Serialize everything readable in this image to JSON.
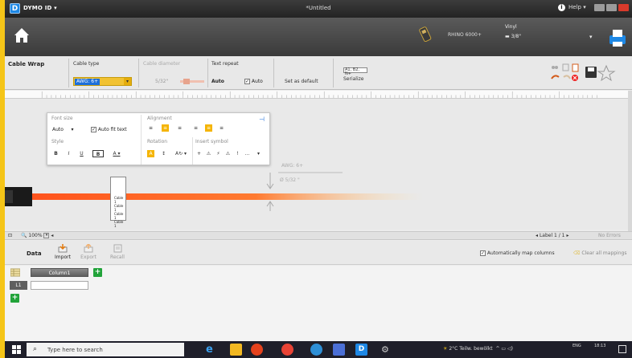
{
  "app": {
    "name": "DYMO ID",
    "document_title": "*Untitled",
    "help_label": "Help"
  },
  "toolbar": {
    "printer_name": "RHINO 6000+",
    "label_type": "Vinyl",
    "label_size": "3/8\""
  },
  "ribbon": {
    "title": "Cable Wrap",
    "cable_type_label": "Cable type",
    "cable_type_value": "AWG: 6+",
    "cable_diameter_label": "Cable diameter",
    "cable_diameter_value": "5/32\"",
    "text_repeat_label": "Text repeat",
    "text_repeat_value": "Auto",
    "auto_checkbox_label": "Auto",
    "set_default_label": "Set as default",
    "serialize_tag": "A1, B2, N+",
    "serialize_label": "Serialize"
  },
  "format_panel": {
    "font_size_label": "Font size",
    "font_size_value": "Auto",
    "auto_fit_label": "Auto fit text",
    "style_label": "Style",
    "style_buttons": [
      "B",
      "I",
      "U",
      "B",
      "A"
    ],
    "alignment_label": "Alignment",
    "rotation_label": "Rotation",
    "rotation_value": "A",
    "insert_symbol_label": "Insert symbol",
    "symbols": [
      "+",
      "⚠",
      "⚡",
      "⚠",
      "!",
      "…"
    ]
  },
  "canvas": {
    "label_lines": [
      "Cable 1",
      "Cable 1",
      "Cable 1",
      "Cable 1"
    ],
    "awg_annotation": "AWG: 6+",
    "diameter_annotation": "Ø 5/32 \""
  },
  "status": {
    "zoom": "100%",
    "label_counter": "Label 1 / 1",
    "errors": "No Errors"
  },
  "data_panel": {
    "title": "Data",
    "import_label": "Import",
    "export_label": "Export",
    "recall_label": "Recall",
    "auto_map_label": "Automatically map columns",
    "clear_mappings_label": "Clear all mappings",
    "column_header": "Column1",
    "row_label": "L1",
    "cell_value": ""
  },
  "taskbar": {
    "search_placeholder": "Type here to search",
    "weather": "2°C  Teilw. bewölkt",
    "lang": "ENG",
    "time": "18:13"
  },
  "colors": {
    "accent_orange": "#f5b400",
    "cable_red": "#ff5a1f",
    "brand_blue": "#1e6fd9",
    "add_green": "#22a33a"
  }
}
